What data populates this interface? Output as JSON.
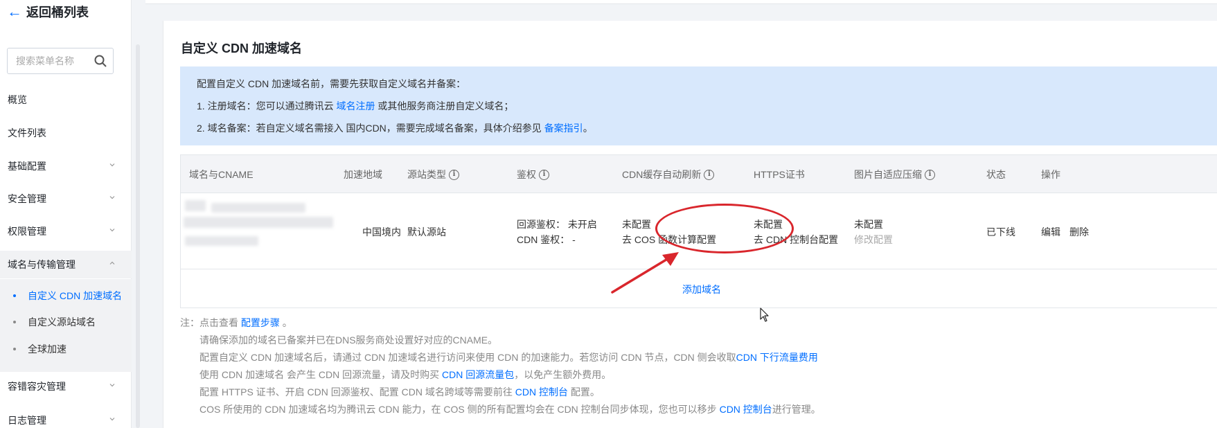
{
  "sidebar": {
    "back_label": "返回桶列表",
    "search_placeholder": "搜索菜单名称",
    "items": [
      {
        "label": "概览"
      },
      {
        "label": "文件列表"
      },
      {
        "label": "基础配置"
      },
      {
        "label": "安全管理"
      },
      {
        "label": "权限管理"
      },
      {
        "label": "域名与传输管理"
      },
      {
        "label": "容错容灾管理"
      },
      {
        "label": "日志管理"
      }
    ],
    "sub_items": [
      {
        "label": "自定义 CDN 加速域名"
      },
      {
        "label": "自定义源站域名"
      },
      {
        "label": "全球加速"
      }
    ]
  },
  "main": {
    "title": "自定义 CDN 加速域名",
    "notice": {
      "line1": "配置自定义 CDN 加速域名前，需要先获取自定义域名并备案：",
      "line2_prefix": "1. 注册域名：您可以通过腾讯云 ",
      "line2_link": "域名注册",
      "line2_suffix": " 或其他服务商注册自定义域名；",
      "line3_prefix": "2. 域名备案：若自定义域名需接入 国内CDN，需要完成域名备案，具体介绍参见 ",
      "line3_link": "备案指引",
      "line3_suffix": "。"
    },
    "table": {
      "headers": {
        "domain": "域名与CNAME",
        "region": "加速地域",
        "origin": "源站类型",
        "auth": "鉴权",
        "refresh": "CDN缓存自动刷新",
        "https": "HTTPS证书",
        "image": "图片自适应压缩",
        "status": "状态",
        "ops": "操作"
      },
      "row": {
        "region": "中国境内",
        "origin": "默认源站",
        "auth_line1": "回源鉴权： 未开启",
        "auth_line2": "CDN 鉴权： -",
        "refresh_status": "未配置",
        "refresh_link": "去 COS 函数计算配置",
        "https_status": "未配置",
        "https_link": "去 CDN 控制台配置",
        "image_status": "未配置",
        "image_link": "修改配置",
        "status": "已下线",
        "edit": "编辑",
        "delete": "删除"
      },
      "add_domain": "添加域名"
    },
    "notes": {
      "n1_prefix": "注：点击查看 ",
      "n1_link": "配置步骤",
      "n1_suffix": " 。",
      "n2": "请确保添加的域名已备案并已在DNS服务商处设置好对应的CNAME。",
      "n3_prefix": "配置自定义 CDN 加速域名后，请通过 CDN 加速域名进行访问来使用 CDN 的加速能力。若您访问 CDN 节点，CDN 侧会收取",
      "n3_link": "CDN 下行流量费用",
      "n4_prefix": "使用 CDN 加速域名 会产生 CDN 回源流量，请及时购买 ",
      "n4_link": "CDN 回源流量包",
      "n4_suffix": "，以免产生额外费用。",
      "n5_prefix": "配置 HTTPS 证书、开启 CDN 回源鉴权、配置 CDN 域名跨域等需要前往 ",
      "n5_link": "CDN 控制台",
      "n5_suffix": " 配置。",
      "n6_prefix": "COS 所使用的 CDN 加速域名均为腾讯云 CDN 能力，在 COS 侧的所有配置均会在 CDN 控制台同步体现，您也可以移步 ",
      "n6_link": "CDN 控制台",
      "n6_suffix": "进行管理。"
    }
  },
  "colors": {
    "link": "#006eff",
    "annotation": "#d9262c",
    "notice_bg": "#d8e8fc"
  }
}
